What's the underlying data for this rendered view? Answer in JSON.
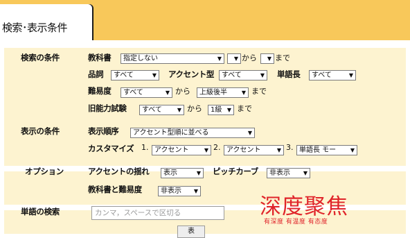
{
  "tab": {
    "label": "検索･表示条件"
  },
  "search": {
    "section_label": "検索の条件",
    "textbook": {
      "label": "教科書",
      "value": "指定しない",
      "range_from": "",
      "from_text": "から",
      "range_to": "",
      "to_text": "まで"
    },
    "pos": {
      "label": "品詞",
      "value": "すべて"
    },
    "accent_type": {
      "label": "アクセント型",
      "value": "すべて"
    },
    "word_length": {
      "label": "単語長",
      "value": "すべて"
    },
    "difficulty": {
      "label": "難易度",
      "from": "すべて",
      "from_text": "から",
      "to": "上級後半",
      "to_text": "まで"
    },
    "old_jlpt": {
      "label": "旧能力試験",
      "from": "すべて",
      "from_text": "から",
      "to": "1級",
      "to_text": "まで"
    }
  },
  "display": {
    "section_label": "表示の条件",
    "order": {
      "label": "表示順序",
      "value": "アクセント型順に並べる"
    },
    "customize": {
      "label": "カスタマイズ",
      "items": [
        {
          "num": "1.",
          "value": "アクセント"
        },
        {
          "num": "2.",
          "value": "アクセント"
        },
        {
          "num": "3.",
          "value": "単語長 モー"
        }
      ]
    }
  },
  "options": {
    "section_label": "オプション",
    "accent_fluctuation": {
      "label": "アクセントの揺れ",
      "value": "表示"
    },
    "pitch_curve": {
      "label": "ピッチカーブ",
      "value": "非表示"
    },
    "textbook_difficulty": {
      "label": "教科書と難易度",
      "value": "非表示"
    }
  },
  "word_search": {
    "section_label": "単語の検索",
    "placeholder": "カンマ，スペースで区切る",
    "button_label": "表"
  },
  "watermark": {
    "title": "深度聚焦",
    "subtitle": "有深度 有温度 有态度"
  },
  "colors": {
    "tab_bar": "#f8c85a",
    "panel": "#fdf3d0",
    "watermark": "#e0242a"
  }
}
